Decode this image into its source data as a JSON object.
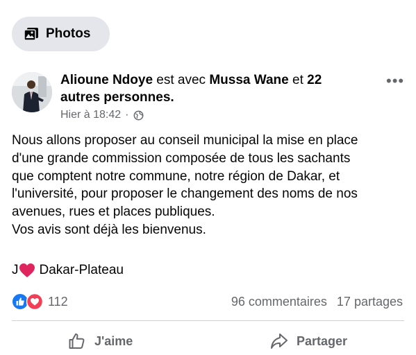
{
  "header_chip": {
    "label": "Photos",
    "icon": "photo-album-icon"
  },
  "post": {
    "author": "Alioune Ndoye",
    "connector1": "est avec",
    "tagged": "Mussa Wane",
    "connector2": "et",
    "others": "22 autres personnes.",
    "time": "Hier à 18:42",
    "separator": "·",
    "audience_icon": "globe-icon",
    "more_icon": "more-options-icon",
    "body_lines": [
      "Nous allons proposer au conseil municipal la mise en place",
      "d'une grande commission composée de tous les sachants",
      "que comptent notre commune, notre région de Dakar, et",
      "l'université, pour proposer le changement des noms de nos",
      "avenues, rues et places publiques.",
      "Vos avis sont déjà les bienvenus."
    ],
    "signature_prefix": "J",
    "signature_place": "Dakar-Plateau"
  },
  "engagement": {
    "reaction_count": "112",
    "comments": "96 commentaires",
    "shares": "17 partages"
  },
  "actions": {
    "like": "J'aime",
    "share": "Partager"
  },
  "colors": {
    "like_blue": "#1877f2",
    "love_red": "#f33e58",
    "heart_red": "#e0245e",
    "muted": "#65676b",
    "chip_bg": "#e4e6eb"
  }
}
